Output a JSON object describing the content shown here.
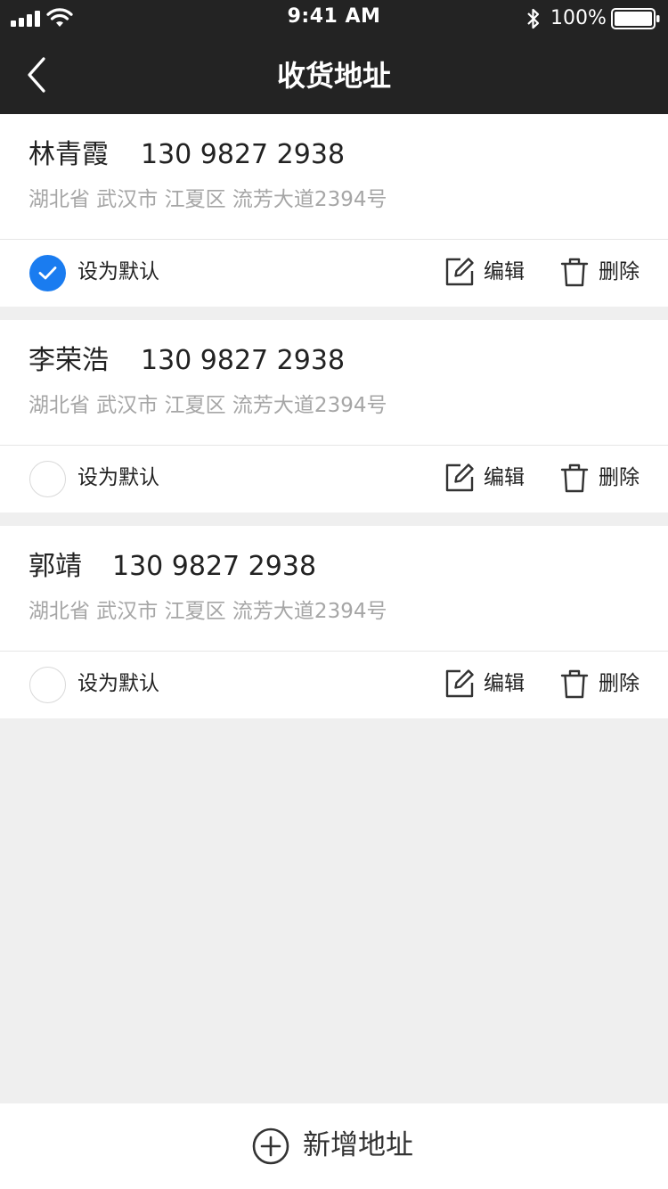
{
  "status_bar": {
    "time": "9:41 AM",
    "battery_text": "100%",
    "icons": [
      "signal-icon",
      "wifi-icon",
      "bluetooth-icon",
      "battery-icon"
    ]
  },
  "nav": {
    "title": "收货地址",
    "back_icon": "chevron-left-icon"
  },
  "addresses": [
    {
      "name": "林青霞",
      "phone": "130 9827 2938",
      "address": "湖北省 武汉市 江夏区 流芳大道2394号",
      "is_default": true,
      "default_label": "设为默认",
      "edit_label": "编辑",
      "delete_label": "删除"
    },
    {
      "name": "李荣浩",
      "phone": "130 9827 2938",
      "address": "湖北省 武汉市 江夏区 流芳大道2394号",
      "is_default": false,
      "default_label": "设为默认",
      "edit_label": "编辑",
      "delete_label": "删除"
    },
    {
      "name": "郭靖",
      "phone": "130 9827 2938",
      "address": "湖北省 武汉市 江夏区 流芳大道2394号",
      "is_default": false,
      "default_label": "设为默认",
      "edit_label": "编辑",
      "delete_label": "删除"
    }
  ],
  "add_button": {
    "label": "新增地址",
    "icon": "plus-circle-icon"
  },
  "colors": {
    "header_bg": "#232323",
    "accent": "#1a7cf0",
    "page_bg": "#efefef",
    "address_text": "#a6a6a6"
  }
}
